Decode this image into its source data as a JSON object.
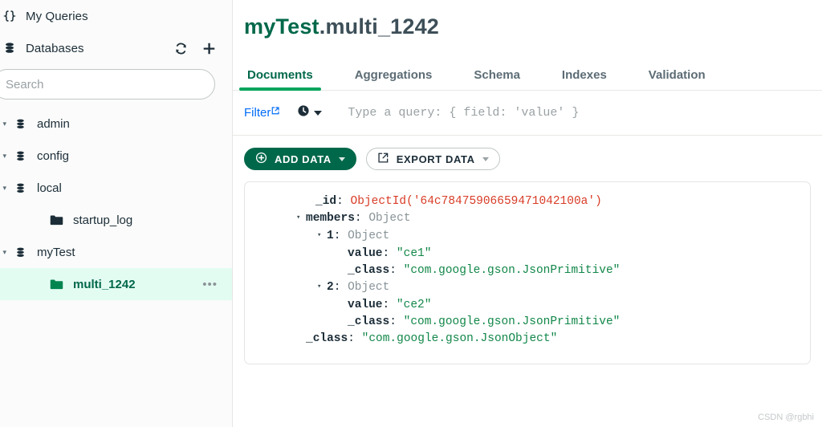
{
  "sidebar": {
    "my_queries_label": "My Queries",
    "databases_label": "Databases",
    "refresh_icon": "refresh-icon",
    "add_icon": "plus-icon",
    "search_placeholder": "Search",
    "search_value": "",
    "tree": [
      {
        "name": "admin",
        "type": "database",
        "selected": false
      },
      {
        "name": "config",
        "type": "database",
        "selected": false
      },
      {
        "name": "local",
        "type": "database",
        "selected": false
      },
      {
        "name": "startup_log",
        "type": "collection",
        "selected": false
      },
      {
        "name": "myTest",
        "type": "database",
        "selected": false
      },
      {
        "name": "multi_1242",
        "type": "collection",
        "selected": true,
        "menu": "•••"
      }
    ]
  },
  "main": {
    "namespace": {
      "database": "myTest",
      "separator": ".",
      "collection": "multi_1242"
    },
    "tabs": [
      {
        "label": "Documents",
        "active": true
      },
      {
        "label": "Aggregations",
        "active": false
      },
      {
        "label": "Schema",
        "active": false
      },
      {
        "label": "Indexes",
        "active": false
      },
      {
        "label": "Validation",
        "active": false
      }
    ],
    "filter_bar": {
      "filter_label": "Filter",
      "history_icon": "clock-icon",
      "query_placeholder": "Type a query: { field: 'value' }",
      "query_value": ""
    },
    "actions": {
      "add_data_label": "ADD DATA",
      "export_data_label": "EXPORT DATA"
    },
    "document": {
      "lines": [
        {
          "indent": 1,
          "arrow": "",
          "key": "_id",
          "type": "objectid",
          "value": "ObjectId('64c78475906659471042100a')"
        },
        {
          "indent": 0,
          "arrow": "▾",
          "key": "members",
          "type": "object",
          "value": "Object"
        },
        {
          "indent": 1,
          "arrow": "▾",
          "key": "1",
          "type": "object",
          "value": "Object"
        },
        {
          "indent": 2,
          "arrow": "",
          "key": "value",
          "type": "string",
          "value": "\"ce1\""
        },
        {
          "indent": 2,
          "arrow": "",
          "key": "_class",
          "type": "string",
          "value": "\"com.google.gson.JsonPrimitive\""
        },
        {
          "indent": 1,
          "arrow": "▾",
          "key": "2",
          "type": "object",
          "value": "Object"
        },
        {
          "indent": 2,
          "arrow": "",
          "key": "value",
          "type": "string",
          "value": "\"ce2\""
        },
        {
          "indent": 2,
          "arrow": "",
          "key": "_class",
          "type": "string",
          "value": "\"com.google.gson.JsonPrimitive\""
        },
        {
          "indent": 0,
          "arrow": "",
          "key": "_class",
          "type": "string",
          "value": "\"com.google.gson.JsonObject\""
        }
      ]
    }
  },
  "watermark": "CSDN @rgbhi",
  "colors": {
    "brand_green": "#00684a",
    "accent_green": "#00a35c",
    "selected_row_bg": "#e3fcf2",
    "link_blue": "#016bf8",
    "objectid_red": "#d83c27",
    "string_green": "#128749",
    "type_gray": "#889397"
  }
}
